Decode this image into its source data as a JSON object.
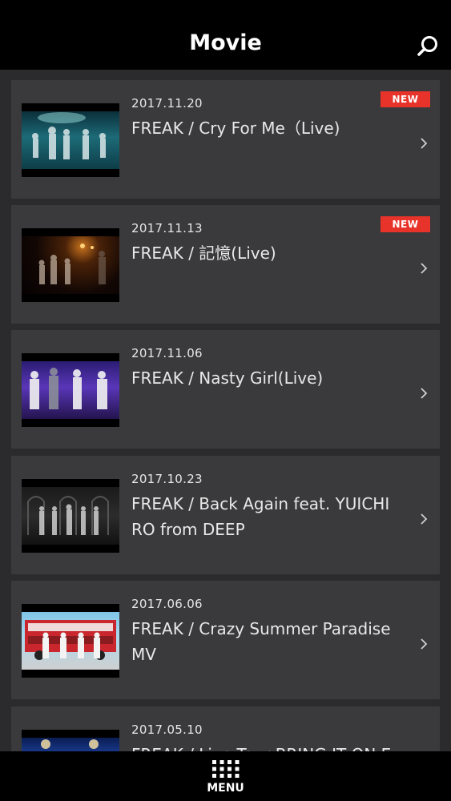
{
  "header": {
    "title": "Movie",
    "search_icon": "search-icon"
  },
  "items": [
    {
      "date": "2017.11.20",
      "title": "FREAK / Cry For Me（Live)",
      "badge": "NEW"
    },
    {
      "date": "2017.11.13",
      "title": "FREAK / 記憶(Live)",
      "badge": "NEW"
    },
    {
      "date": "2017.11.06",
      "title": "FREAK / Nasty Girl(Live)"
    },
    {
      "date": "2017.10.23",
      "title": "FREAK / Back Again feat. YUICHI RO from DEEP"
    },
    {
      "date": "2017.06.06",
      "title": "FREAK / Crazy Summer Paradise MV"
    },
    {
      "date": "2017.05.10",
      "title": "FREAK / Live Tour BRING IT ON Ex"
    }
  ],
  "footer": {
    "menu_label": "MENU",
    "menu_icon": "grid-menu-icon"
  },
  "colors": {
    "header_bg": "#000000",
    "card_bg": "#3a3a3c",
    "page_bg": "#2b2b2d",
    "badge_bg": "#e8332a"
  }
}
